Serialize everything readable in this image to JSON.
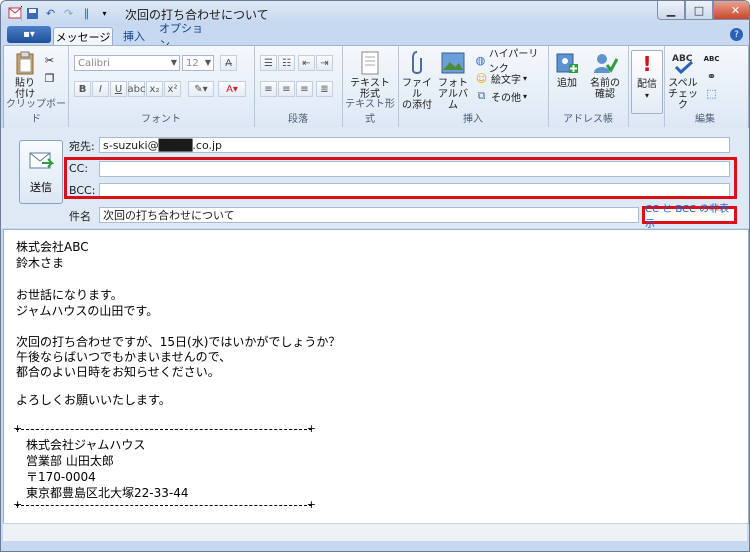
{
  "window": {
    "title": "次回の打ち合わせについて"
  },
  "tabs": [
    {
      "label": "メッセージ",
      "active": true
    },
    {
      "label": "挿入",
      "active": false
    },
    {
      "label": "オプション",
      "active": false
    }
  ],
  "ribbon": {
    "clipboard": {
      "paste": "貼り付け",
      "group": "クリップボード"
    },
    "font": {
      "name": "Calibri",
      "size": "12",
      "group": "フォント"
    },
    "paragraph": {
      "group": "段落"
    },
    "text_format": {
      "label": "テキスト形式",
      "group": "テキスト形式"
    },
    "insert": {
      "attach": "ファイルの添付",
      "attach_l1": "ファイル",
      "attach_l2": "の添付",
      "photo_l1": "フォト",
      "photo_l2": "アルバム",
      "hyperlink": "ハイパーリンク",
      "emoji": "絵文字",
      "other": "その他",
      "group": "挿入"
    },
    "addressbook": {
      "add": "追加",
      "confirm_l1": "名前の",
      "confirm_l2": "確認",
      "group": "アドレス帳"
    },
    "delivery": {
      "label": "配信",
      "group": ""
    },
    "edit": {
      "spell_l1": "スペル",
      "spell_l2": "チェック",
      "group": "編集"
    }
  },
  "header": {
    "send_label": "送信",
    "to_label": "宛先:",
    "to_value": "s-suzuki@████.co.jp",
    "cc_label": "CC:",
    "cc_value": "",
    "bcc_label": "BCC:",
    "bcc_value": "",
    "subject_label": "件名",
    "subject_value": "次回の打ち合わせについて",
    "cc_bcc_toggle": "CC と BCC の非表示"
  },
  "body": {
    "lines": [
      "株式会社ABC",
      "鈴木さま",
      "",
      "お世話になります。",
      "ジャムハウスの山田です。",
      "",
      "次回の打ち合わせですが、15日(水)ではいかがでしょうか？",
      "午後ならばいつでもかまいませんので、",
      "都合のよい日時をお知らせください。",
      "",
      "よろしくお願いいたします。"
    ],
    "signature": [
      "株式会社ジャムハウス",
      "営業部 山田太郎",
      "〒170-0004",
      "東京都豊島区北大塚22-33-44"
    ]
  },
  "colors": {
    "highlight_red": "#d8101a",
    "link_blue": "#1f5ec9"
  }
}
